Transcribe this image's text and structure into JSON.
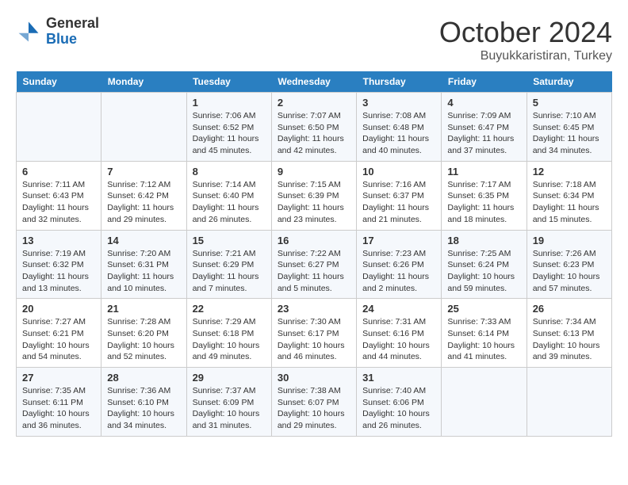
{
  "logo": {
    "general": "General",
    "blue": "Blue"
  },
  "title": "October 2024",
  "subtitle": "Buyukkaristiran, Turkey",
  "days_of_week": [
    "Sunday",
    "Monday",
    "Tuesday",
    "Wednesday",
    "Thursday",
    "Friday",
    "Saturday"
  ],
  "weeks": [
    [
      {
        "day": "",
        "content": ""
      },
      {
        "day": "",
        "content": ""
      },
      {
        "day": "1",
        "content": "Sunrise: 7:06 AM\nSunset: 6:52 PM\nDaylight: 11 hours and 45 minutes."
      },
      {
        "day": "2",
        "content": "Sunrise: 7:07 AM\nSunset: 6:50 PM\nDaylight: 11 hours and 42 minutes."
      },
      {
        "day": "3",
        "content": "Sunrise: 7:08 AM\nSunset: 6:48 PM\nDaylight: 11 hours and 40 minutes."
      },
      {
        "day": "4",
        "content": "Sunrise: 7:09 AM\nSunset: 6:47 PM\nDaylight: 11 hours and 37 minutes."
      },
      {
        "day": "5",
        "content": "Sunrise: 7:10 AM\nSunset: 6:45 PM\nDaylight: 11 hours and 34 minutes."
      }
    ],
    [
      {
        "day": "6",
        "content": "Sunrise: 7:11 AM\nSunset: 6:43 PM\nDaylight: 11 hours and 32 minutes."
      },
      {
        "day": "7",
        "content": "Sunrise: 7:12 AM\nSunset: 6:42 PM\nDaylight: 11 hours and 29 minutes."
      },
      {
        "day": "8",
        "content": "Sunrise: 7:14 AM\nSunset: 6:40 PM\nDaylight: 11 hours and 26 minutes."
      },
      {
        "day": "9",
        "content": "Sunrise: 7:15 AM\nSunset: 6:39 PM\nDaylight: 11 hours and 23 minutes."
      },
      {
        "day": "10",
        "content": "Sunrise: 7:16 AM\nSunset: 6:37 PM\nDaylight: 11 hours and 21 minutes."
      },
      {
        "day": "11",
        "content": "Sunrise: 7:17 AM\nSunset: 6:35 PM\nDaylight: 11 hours and 18 minutes."
      },
      {
        "day": "12",
        "content": "Sunrise: 7:18 AM\nSunset: 6:34 PM\nDaylight: 11 hours and 15 minutes."
      }
    ],
    [
      {
        "day": "13",
        "content": "Sunrise: 7:19 AM\nSunset: 6:32 PM\nDaylight: 11 hours and 13 minutes."
      },
      {
        "day": "14",
        "content": "Sunrise: 7:20 AM\nSunset: 6:31 PM\nDaylight: 11 hours and 10 minutes."
      },
      {
        "day": "15",
        "content": "Sunrise: 7:21 AM\nSunset: 6:29 PM\nDaylight: 11 hours and 7 minutes."
      },
      {
        "day": "16",
        "content": "Sunrise: 7:22 AM\nSunset: 6:27 PM\nDaylight: 11 hours and 5 minutes."
      },
      {
        "day": "17",
        "content": "Sunrise: 7:23 AM\nSunset: 6:26 PM\nDaylight: 11 hours and 2 minutes."
      },
      {
        "day": "18",
        "content": "Sunrise: 7:25 AM\nSunset: 6:24 PM\nDaylight: 10 hours and 59 minutes."
      },
      {
        "day": "19",
        "content": "Sunrise: 7:26 AM\nSunset: 6:23 PM\nDaylight: 10 hours and 57 minutes."
      }
    ],
    [
      {
        "day": "20",
        "content": "Sunrise: 7:27 AM\nSunset: 6:21 PM\nDaylight: 10 hours and 54 minutes."
      },
      {
        "day": "21",
        "content": "Sunrise: 7:28 AM\nSunset: 6:20 PM\nDaylight: 10 hours and 52 minutes."
      },
      {
        "day": "22",
        "content": "Sunrise: 7:29 AM\nSunset: 6:18 PM\nDaylight: 10 hours and 49 minutes."
      },
      {
        "day": "23",
        "content": "Sunrise: 7:30 AM\nSunset: 6:17 PM\nDaylight: 10 hours and 46 minutes."
      },
      {
        "day": "24",
        "content": "Sunrise: 7:31 AM\nSunset: 6:16 PM\nDaylight: 10 hours and 44 minutes."
      },
      {
        "day": "25",
        "content": "Sunrise: 7:33 AM\nSunset: 6:14 PM\nDaylight: 10 hours and 41 minutes."
      },
      {
        "day": "26",
        "content": "Sunrise: 7:34 AM\nSunset: 6:13 PM\nDaylight: 10 hours and 39 minutes."
      }
    ],
    [
      {
        "day": "27",
        "content": "Sunrise: 7:35 AM\nSunset: 6:11 PM\nDaylight: 10 hours and 36 minutes."
      },
      {
        "day": "28",
        "content": "Sunrise: 7:36 AM\nSunset: 6:10 PM\nDaylight: 10 hours and 34 minutes."
      },
      {
        "day": "29",
        "content": "Sunrise: 7:37 AM\nSunset: 6:09 PM\nDaylight: 10 hours and 31 minutes."
      },
      {
        "day": "30",
        "content": "Sunrise: 7:38 AM\nSunset: 6:07 PM\nDaylight: 10 hours and 29 minutes."
      },
      {
        "day": "31",
        "content": "Sunrise: 7:40 AM\nSunset: 6:06 PM\nDaylight: 10 hours and 26 minutes."
      },
      {
        "day": "",
        "content": ""
      },
      {
        "day": "",
        "content": ""
      }
    ]
  ]
}
